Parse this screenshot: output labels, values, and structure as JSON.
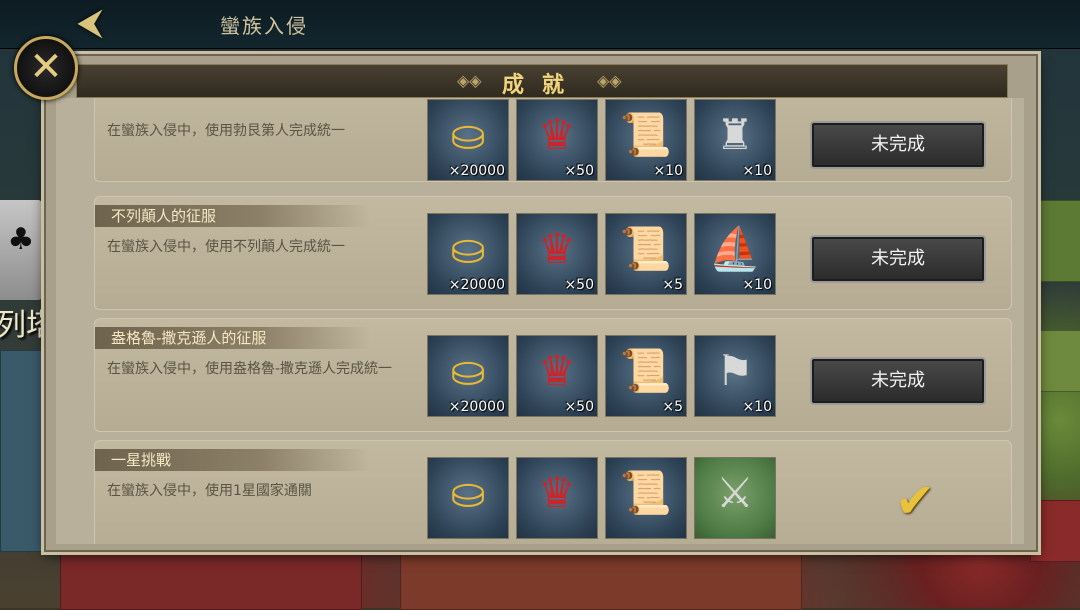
{
  "topbar": {
    "back_icon": "back-arrow-icon",
    "title": "蠻族入侵"
  },
  "left_panel": {
    "label": "列塔"
  },
  "dialog": {
    "title": "成就",
    "close_icon": "close-icon"
  },
  "achievements": [
    {
      "title": "",
      "description": "在蠻族入侵中，使用勃艮第人完成統一",
      "rewards": [
        {
          "icon": "gold-coins-icon",
          "qty": "×20000"
        },
        {
          "icon": "crest-medal-icon",
          "qty": "×50"
        },
        {
          "icon": "scroll-icon",
          "qty": "×10"
        },
        {
          "icon": "siege-tower-piece-icon",
          "qty": "×10"
        }
      ],
      "status": "未完成",
      "completed": false
    },
    {
      "title": "不列顛人的征服",
      "description": "在蠻族入侵中，使用不列顛人完成統一",
      "rewards": [
        {
          "icon": "gold-coins-icon",
          "qty": "×20000"
        },
        {
          "icon": "crest-medal-icon",
          "qty": "×50"
        },
        {
          "icon": "scroll-icon",
          "qty": "×5"
        },
        {
          "icon": "ship-piece-icon",
          "qty": "×10"
        }
      ],
      "status": "未完成",
      "completed": false
    },
    {
      "title": "盎格魯-撒克遜人的征服",
      "description": "在蠻族入侵中，使用盎格魯-撒克遜人完成統一",
      "rewards": [
        {
          "icon": "gold-coins-icon",
          "qty": "×20000"
        },
        {
          "icon": "crest-medal-icon",
          "qty": "×50"
        },
        {
          "icon": "scroll-icon",
          "qty": "×5"
        },
        {
          "icon": "catapult-piece-icon",
          "qty": "×10"
        }
      ],
      "status": "未完成",
      "completed": false
    },
    {
      "title": "一星挑戰",
      "description": "在蠻族入侵中，使用1星國家通關",
      "rewards": [
        {
          "icon": "gold-coins-icon",
          "qty": ""
        },
        {
          "icon": "crest-medal-icon",
          "qty": ""
        },
        {
          "icon": "scroll-icon",
          "qty": ""
        },
        {
          "icon": "crossed-swords-icon",
          "qty": ""
        }
      ],
      "status": "",
      "completed": true
    }
  ],
  "colors": {
    "accent_gold": "#f2d57a",
    "panel": "#b8b09a",
    "button_dark": "#2a2a2a"
  }
}
